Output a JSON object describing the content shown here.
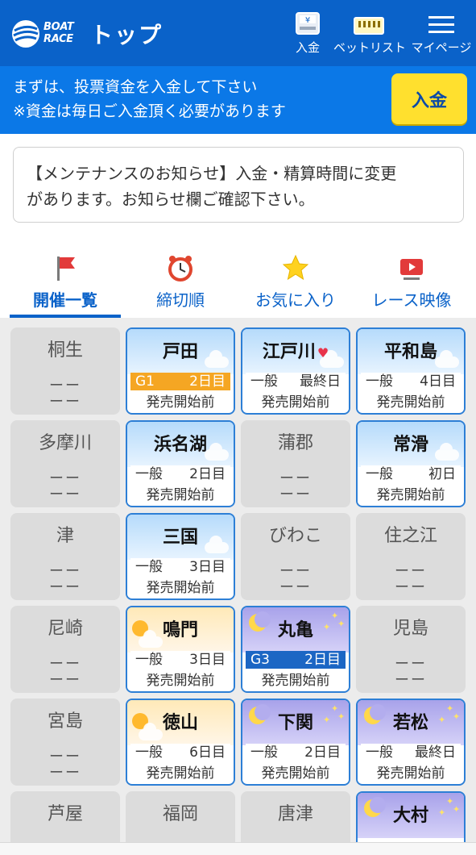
{
  "header": {
    "logo_text_line1": "BOAT",
    "logo_text_line2": "RACE",
    "title": "トップ",
    "deposit_label": "入金",
    "betlist_label": "ベットリスト",
    "mypage_label": "マイページ",
    "deposit_icon_glyph": "¥"
  },
  "deposit_banner": {
    "line1": "まずは、投票資金を入金して下さい",
    "line2": "※資金は毎日ご入金頂く必要があります",
    "button_label": "入金"
  },
  "notice": {
    "text_line1": "【メンテナンスのお知らせ】入金・精算時間に変更",
    "text_line2": "があります。お知らせ欄ご確認下さい。"
  },
  "tabs": [
    {
      "label": "開催一覧",
      "icon": "flag-icon",
      "active": true
    },
    {
      "label": "締切順",
      "icon": "alarm-clock-icon",
      "active": false
    },
    {
      "label": "お気に入り",
      "icon": "star-icon",
      "active": false
    },
    {
      "label": "レース映像",
      "icon": "video-play-icon",
      "active": false
    }
  ],
  "venues": [
    {
      "name": "桐生",
      "state": "inactive",
      "line1": "ーー",
      "line2": "ーー"
    },
    {
      "name": "戸田",
      "state": "active",
      "sky": "day",
      "grade": "G1",
      "day": "2日目",
      "grade_style": "g1",
      "status": "発売開始前"
    },
    {
      "name": "江戸川",
      "state": "active",
      "sky": "day",
      "grade": "一般",
      "day": "最終日",
      "grade_style": "normal",
      "status": "発売開始前",
      "favorite": "♥"
    },
    {
      "name": "平和島",
      "state": "active",
      "sky": "day",
      "grade": "一般",
      "day": "4日目",
      "grade_style": "normal",
      "status": "発売開始前"
    },
    {
      "name": "多摩川",
      "state": "inactive",
      "line1": "ーー",
      "line2": "ーー"
    },
    {
      "name": "浜名湖",
      "state": "active",
      "sky": "day",
      "grade": "一般",
      "day": "2日目",
      "grade_style": "normal",
      "status": "発売開始前"
    },
    {
      "name": "蒲郡",
      "state": "inactive",
      "line1": "ーー",
      "line2": "ーー"
    },
    {
      "name": "常滑",
      "state": "active",
      "sky": "day",
      "grade": "一般",
      "day": "初日",
      "grade_style": "normal",
      "status": "発売開始前"
    },
    {
      "name": "津",
      "state": "inactive",
      "line1": "ーー",
      "line2": "ーー"
    },
    {
      "name": "三国",
      "state": "active",
      "sky": "day",
      "grade": "一般",
      "day": "3日目",
      "grade_style": "normal",
      "status": "発売開始前"
    },
    {
      "name": "びわこ",
      "state": "inactive",
      "line1": "ーー",
      "line2": "ーー"
    },
    {
      "name": "住之江",
      "state": "inactive",
      "line1": "ーー",
      "line2": "ーー"
    },
    {
      "name": "尼崎",
      "state": "inactive",
      "line1": "ーー",
      "line2": "ーー"
    },
    {
      "name": "鳴門",
      "state": "active",
      "sky": "evening",
      "grade": "一般",
      "day": "3日目",
      "grade_style": "normal",
      "status": "発売開始前"
    },
    {
      "name": "丸亀",
      "state": "active",
      "sky": "night",
      "grade": "G3",
      "day": "2日目",
      "grade_style": "g3",
      "status": "発売開始前"
    },
    {
      "name": "児島",
      "state": "inactive",
      "line1": "ーー",
      "line2": "ーー"
    },
    {
      "name": "宮島",
      "state": "inactive",
      "line1": "ーー",
      "line2": "ーー"
    },
    {
      "name": "徳山",
      "state": "active",
      "sky": "evening",
      "grade": "一般",
      "day": "6日目",
      "grade_style": "normal",
      "status": "発売開始前"
    },
    {
      "name": "下関",
      "state": "active",
      "sky": "night",
      "grade": "一般",
      "day": "2日目",
      "grade_style": "normal",
      "status": "発売開始前"
    },
    {
      "name": "若松",
      "state": "active",
      "sky": "night",
      "grade": "一般",
      "day": "最終日",
      "grade_style": "normal",
      "status": "発売開始前"
    },
    {
      "name": "芦屋",
      "state": "inactive",
      "line1": "",
      "line2": ""
    },
    {
      "name": "福岡",
      "state": "inactive",
      "line1": "",
      "line2": ""
    },
    {
      "name": "唐津",
      "state": "inactive",
      "line1": "",
      "line2": ""
    },
    {
      "name": "大村",
      "state": "active",
      "sky": "night",
      "grade": "",
      "day": "",
      "grade_style": "normal",
      "status": ""
    }
  ],
  "colors": {
    "header_bg": "#0a62c9",
    "banner_bg": "#0b78e7",
    "deposit_button": "#ffe02e",
    "g1_badge": "#f5a623",
    "g3_badge": "#1c66c4",
    "active_border": "#2d7fd6"
  }
}
